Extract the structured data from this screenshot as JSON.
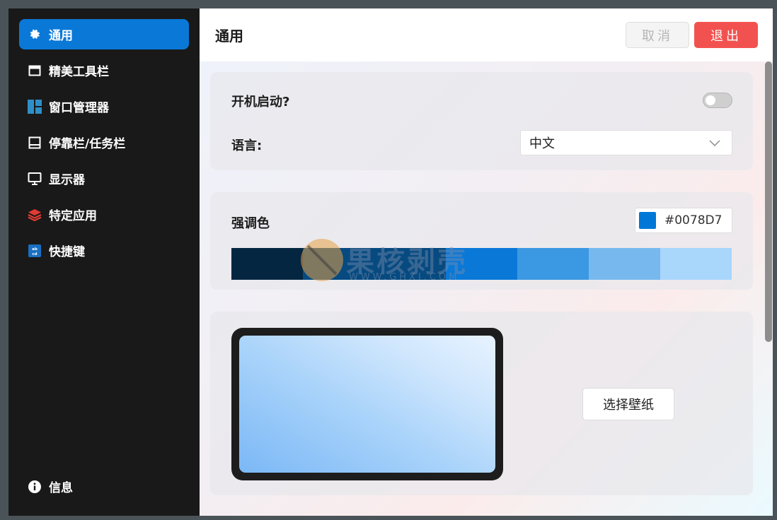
{
  "sidebar": {
    "items": [
      {
        "label": "通用",
        "icon": "gear-icon",
        "active": true
      },
      {
        "label": "精美工具栏",
        "icon": "toolbar-window-icon",
        "active": false
      },
      {
        "label": "窗口管理器",
        "icon": "window-layout-icon",
        "active": false
      },
      {
        "label": "停靠栏/任务栏",
        "icon": "dock-icon",
        "active": false
      },
      {
        "label": "显示器",
        "icon": "monitor-icon",
        "active": false
      },
      {
        "label": "特定应用",
        "icon": "layers-icon",
        "active": false
      },
      {
        "label": "快捷键",
        "icon": "keyboard-shortcut-icon",
        "active": false
      }
    ],
    "bottom": {
      "label": "信息",
      "icon": "info-icon"
    }
  },
  "header": {
    "title": "通用",
    "cancel_label": "取消",
    "exit_label": "退出"
  },
  "general": {
    "autostart_label": "开机启动?",
    "autostart_on": false,
    "language_label": "语言:",
    "language_value": "中文"
  },
  "accent": {
    "label": "强调色",
    "hex": "#0078D7",
    "palette": [
      "#052641",
      "#064a80",
      "#0a78d7",
      "#3b98e2",
      "#77b9ee",
      "#a9d6fb"
    ]
  },
  "wallpaper": {
    "button_label": "选择壁纸"
  },
  "watermark": {
    "text": "果核剥壳",
    "sub": "WWW.GHXI.COM"
  },
  "colors": {
    "accent": "#0A78D7",
    "exit": "#F2524F",
    "sidebar_bg": "#191919"
  }
}
